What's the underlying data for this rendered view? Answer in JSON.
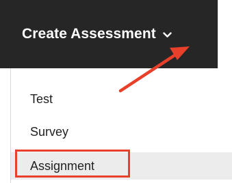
{
  "menu": {
    "title": "Create Assessment",
    "chevron_icon": "chevron-down-icon",
    "items": [
      {
        "label": "Test"
      },
      {
        "label": "Survey"
      },
      {
        "label": "Assignment"
      }
    ]
  },
  "annotation": {
    "arrow_color": "#e8402a",
    "highlight_color": "#e8402a"
  },
  "colors": {
    "header_background": "#262626",
    "header_text": "#ffffff",
    "item_text": "#1f1f1f",
    "hover_background": "#ececec"
  }
}
